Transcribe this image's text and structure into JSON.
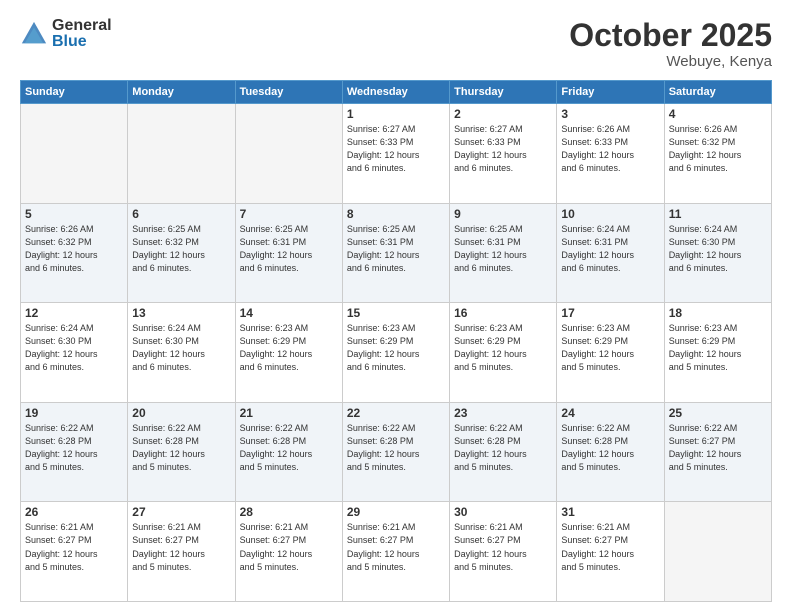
{
  "logo": {
    "general": "General",
    "blue": "Blue"
  },
  "header": {
    "month": "October 2025",
    "location": "Webuye, Kenya"
  },
  "days_of_week": [
    "Sunday",
    "Monday",
    "Tuesday",
    "Wednesday",
    "Thursday",
    "Friday",
    "Saturday"
  ],
  "weeks": [
    [
      {
        "day": "",
        "info": ""
      },
      {
        "day": "",
        "info": ""
      },
      {
        "day": "",
        "info": ""
      },
      {
        "day": "1",
        "info": "Sunrise: 6:27 AM\nSunset: 6:33 PM\nDaylight: 12 hours\nand 6 minutes."
      },
      {
        "day": "2",
        "info": "Sunrise: 6:27 AM\nSunset: 6:33 PM\nDaylight: 12 hours\nand 6 minutes."
      },
      {
        "day": "3",
        "info": "Sunrise: 6:26 AM\nSunset: 6:33 PM\nDaylight: 12 hours\nand 6 minutes."
      },
      {
        "day": "4",
        "info": "Sunrise: 6:26 AM\nSunset: 6:32 PM\nDaylight: 12 hours\nand 6 minutes."
      }
    ],
    [
      {
        "day": "5",
        "info": "Sunrise: 6:26 AM\nSunset: 6:32 PM\nDaylight: 12 hours\nand 6 minutes."
      },
      {
        "day": "6",
        "info": "Sunrise: 6:25 AM\nSunset: 6:32 PM\nDaylight: 12 hours\nand 6 minutes."
      },
      {
        "day": "7",
        "info": "Sunrise: 6:25 AM\nSunset: 6:31 PM\nDaylight: 12 hours\nand 6 minutes."
      },
      {
        "day": "8",
        "info": "Sunrise: 6:25 AM\nSunset: 6:31 PM\nDaylight: 12 hours\nand 6 minutes."
      },
      {
        "day": "9",
        "info": "Sunrise: 6:25 AM\nSunset: 6:31 PM\nDaylight: 12 hours\nand 6 minutes."
      },
      {
        "day": "10",
        "info": "Sunrise: 6:24 AM\nSunset: 6:31 PM\nDaylight: 12 hours\nand 6 minutes."
      },
      {
        "day": "11",
        "info": "Sunrise: 6:24 AM\nSunset: 6:30 PM\nDaylight: 12 hours\nand 6 minutes."
      }
    ],
    [
      {
        "day": "12",
        "info": "Sunrise: 6:24 AM\nSunset: 6:30 PM\nDaylight: 12 hours\nand 6 minutes."
      },
      {
        "day": "13",
        "info": "Sunrise: 6:24 AM\nSunset: 6:30 PM\nDaylight: 12 hours\nand 6 minutes."
      },
      {
        "day": "14",
        "info": "Sunrise: 6:23 AM\nSunset: 6:29 PM\nDaylight: 12 hours\nand 6 minutes."
      },
      {
        "day": "15",
        "info": "Sunrise: 6:23 AM\nSunset: 6:29 PM\nDaylight: 12 hours\nand 6 minutes."
      },
      {
        "day": "16",
        "info": "Sunrise: 6:23 AM\nSunset: 6:29 PM\nDaylight: 12 hours\nand 5 minutes."
      },
      {
        "day": "17",
        "info": "Sunrise: 6:23 AM\nSunset: 6:29 PM\nDaylight: 12 hours\nand 5 minutes."
      },
      {
        "day": "18",
        "info": "Sunrise: 6:23 AM\nSunset: 6:29 PM\nDaylight: 12 hours\nand 5 minutes."
      }
    ],
    [
      {
        "day": "19",
        "info": "Sunrise: 6:22 AM\nSunset: 6:28 PM\nDaylight: 12 hours\nand 5 minutes."
      },
      {
        "day": "20",
        "info": "Sunrise: 6:22 AM\nSunset: 6:28 PM\nDaylight: 12 hours\nand 5 minutes."
      },
      {
        "day": "21",
        "info": "Sunrise: 6:22 AM\nSunset: 6:28 PM\nDaylight: 12 hours\nand 5 minutes."
      },
      {
        "day": "22",
        "info": "Sunrise: 6:22 AM\nSunset: 6:28 PM\nDaylight: 12 hours\nand 5 minutes."
      },
      {
        "day": "23",
        "info": "Sunrise: 6:22 AM\nSunset: 6:28 PM\nDaylight: 12 hours\nand 5 minutes."
      },
      {
        "day": "24",
        "info": "Sunrise: 6:22 AM\nSunset: 6:28 PM\nDaylight: 12 hours\nand 5 minutes."
      },
      {
        "day": "25",
        "info": "Sunrise: 6:22 AM\nSunset: 6:27 PM\nDaylight: 12 hours\nand 5 minutes."
      }
    ],
    [
      {
        "day": "26",
        "info": "Sunrise: 6:21 AM\nSunset: 6:27 PM\nDaylight: 12 hours\nand 5 minutes."
      },
      {
        "day": "27",
        "info": "Sunrise: 6:21 AM\nSunset: 6:27 PM\nDaylight: 12 hours\nand 5 minutes."
      },
      {
        "day": "28",
        "info": "Sunrise: 6:21 AM\nSunset: 6:27 PM\nDaylight: 12 hours\nand 5 minutes."
      },
      {
        "day": "29",
        "info": "Sunrise: 6:21 AM\nSunset: 6:27 PM\nDaylight: 12 hours\nand 5 minutes."
      },
      {
        "day": "30",
        "info": "Sunrise: 6:21 AM\nSunset: 6:27 PM\nDaylight: 12 hours\nand 5 minutes."
      },
      {
        "day": "31",
        "info": "Sunrise: 6:21 AM\nSunset: 6:27 PM\nDaylight: 12 hours\nand 5 minutes."
      },
      {
        "day": "",
        "info": ""
      }
    ]
  ]
}
